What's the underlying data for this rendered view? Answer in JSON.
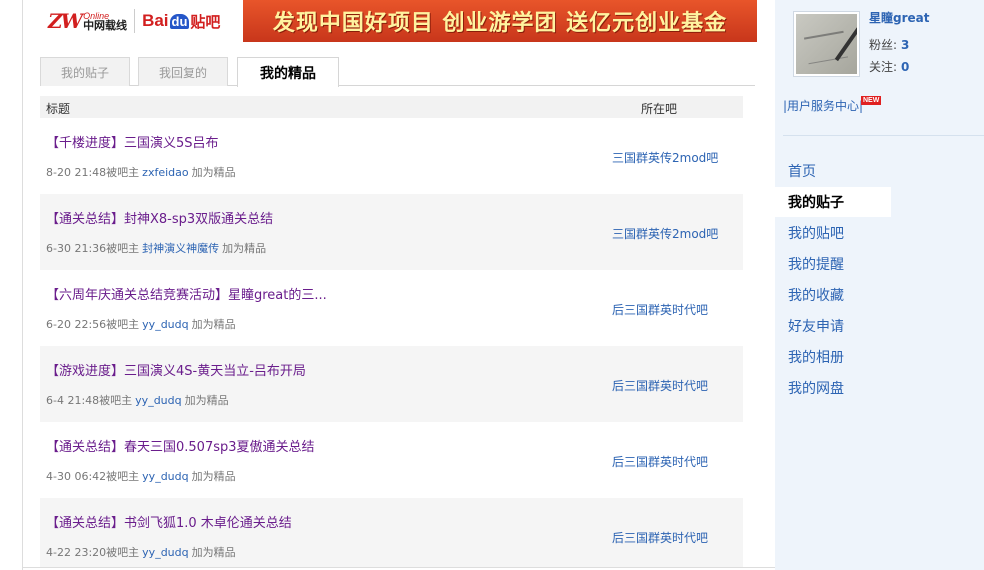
{
  "banner": {
    "zw_mark": "ZW",
    "zw_online": "Online",
    "zw_name": "中网载线",
    "baidu_bai": "Bai",
    "baidu_du": "du",
    "baidu_tieba": "贴吧",
    "ad_text": "发现中国好项目 创业游学团 送亿元创业基金"
  },
  "tabs": [
    {
      "label": "我的贴子",
      "active": false
    },
    {
      "label": "我回复的",
      "active": false
    },
    {
      "label": "我的精品",
      "active": true
    }
  ],
  "table": {
    "col_title": "标题",
    "col_forum": "所在吧",
    "rows": [
      {
        "title": "【千楼进度】三国演义5S吕布",
        "time": "8-20 21:48",
        "by": "被吧主",
        "author": "zxfeidao",
        "action": "加为精品",
        "forum": "三国群英传2mod吧"
      },
      {
        "title": "【通关总结】封神X8-sp3双版通关总结",
        "time": "6-30 21:36",
        "by": "被吧主",
        "author": "封神演义神魔传",
        "action": "加为精品",
        "forum": "三国群英传2mod吧"
      },
      {
        "title": "【六周年庆通关总结竞赛活动】星瞳great的三...",
        "time": "6-20 22:56",
        "by": "被吧主",
        "author": "yy_dudq",
        "action": "加为精品",
        "forum": "后三国群英时代吧"
      },
      {
        "title": "【游戏进度】三国演义4S-黄天当立-吕布开局",
        "time": "6-4 21:48",
        "by": "被吧主",
        "author": "yy_dudq",
        "action": "加为精品",
        "forum": "后三国群英时代吧"
      },
      {
        "title": "【通关总结】春天三国0.507sp3夏傲通关总结",
        "time": "4-30 06:42",
        "by": "被吧主",
        "author": "yy_dudq",
        "action": "加为精品",
        "forum": "后三国群英时代吧"
      },
      {
        "title": "【通关总结】书剑飞狐1.0 木卓伦通关总结",
        "time": "4-22 23:20",
        "by": "被吧主",
        "author": "yy_dudq",
        "action": "加为精品",
        "forum": "后三国群英时代吧"
      }
    ]
  },
  "profile": {
    "username": "星瞳great",
    "fans_label": "粉丝:",
    "fans": "3",
    "follow_label": "关注:",
    "follow": "0",
    "service_center": "|用户服务中心|",
    "new_badge": "NEW"
  },
  "menu": [
    {
      "label": "首页",
      "active": false
    },
    {
      "label": "我的贴子",
      "active": true
    },
    {
      "label": "我的贴吧",
      "active": false
    },
    {
      "label": "我的提醒",
      "active": false
    },
    {
      "label": "我的收藏",
      "active": false
    },
    {
      "label": "好友申请",
      "active": false
    },
    {
      "label": "我的相册",
      "active": false
    },
    {
      "label": "我的网盘",
      "active": false
    }
  ],
  "colors": {
    "link": "#2d64b3",
    "title": "#6a1d8c",
    "sidebar_bg": "#eef4fb",
    "ad_bg": "#d9441f"
  }
}
